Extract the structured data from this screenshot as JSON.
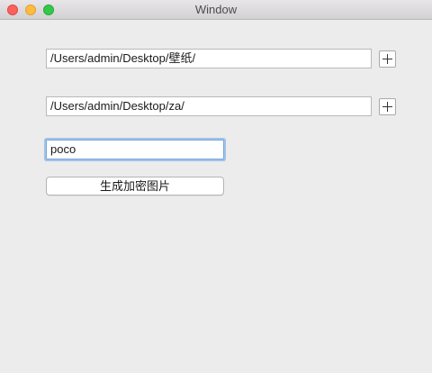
{
  "window": {
    "title": "Window"
  },
  "form": {
    "source_path": "/Users/admin/Desktop/壁纸/",
    "output_path": "/Users/admin/Desktop/za/",
    "password": "poco",
    "generate_button_label": "生成加密图片"
  },
  "colors": {
    "background": "#ececec",
    "close": "#fc605c",
    "minimize": "#fdbc40",
    "maximize": "#34c84a",
    "focus_ring": "#9fc3ea"
  },
  "icons": {
    "add_source": "plus-icon",
    "add_output": "plus-icon"
  }
}
